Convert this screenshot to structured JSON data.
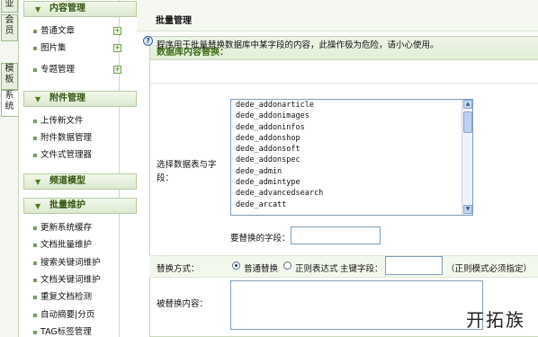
{
  "vtabs": [
    {
      "label": "业",
      "chars": [
        "业"
      ]
    },
    {
      "label": "会员",
      "chars": [
        "会",
        "员"
      ]
    },
    {
      "label": "模板",
      "chars": [
        "模",
        "板"
      ]
    },
    {
      "label": "系统",
      "chars": [
        "系",
        "统"
      ]
    }
  ],
  "sidebar": {
    "groups": [
      {
        "title": "内容管理",
        "items": [
          "普通文章",
          "图片集",
          "专题管理"
        ]
      },
      {
        "title": "附件管理",
        "items": [
          "上传新文件",
          "附件数据管理",
          "文件式管理器"
        ]
      },
      {
        "title": "频道模型",
        "items": []
      },
      {
        "title": "批量维护",
        "items": [
          "更新系统缓存",
          "文档批量维护",
          "搜索关键词维护",
          "文档关键词维护",
          "重复文档检测",
          "自动摘要|分页",
          "TAG标签管理"
        ]
      }
    ],
    "add_icon": "add-icon"
  },
  "main": {
    "top_title": "批量管理",
    "section_title": "数据库内容替换：",
    "info_text": "程序用于批量替换数据库中某字段的内容，此操作极为危险，请小心使用。",
    "select_label": "选择数据表与字段：",
    "tables": [
      "dede_addonarticle",
      "dede_addonimages",
      "dede_addoninfos",
      "dede_addonshop",
      "dede_addonsoft",
      "dede_addonspec",
      "dede_admin",
      "dede_admintype",
      "dede_advancedsearch",
      "dede_arcatt"
    ],
    "field_label": "要替换的字段：",
    "field_value": "",
    "mode_label": "替换方式：",
    "mode_normal": "普通替换",
    "mode_regex": "正则表达式",
    "primary_key_label": "主键字段：",
    "primary_key_value": "",
    "regex_hint": "（正则模式必须指定）",
    "replace_label": "被替换内容："
  },
  "watermark": "开拓族"
}
